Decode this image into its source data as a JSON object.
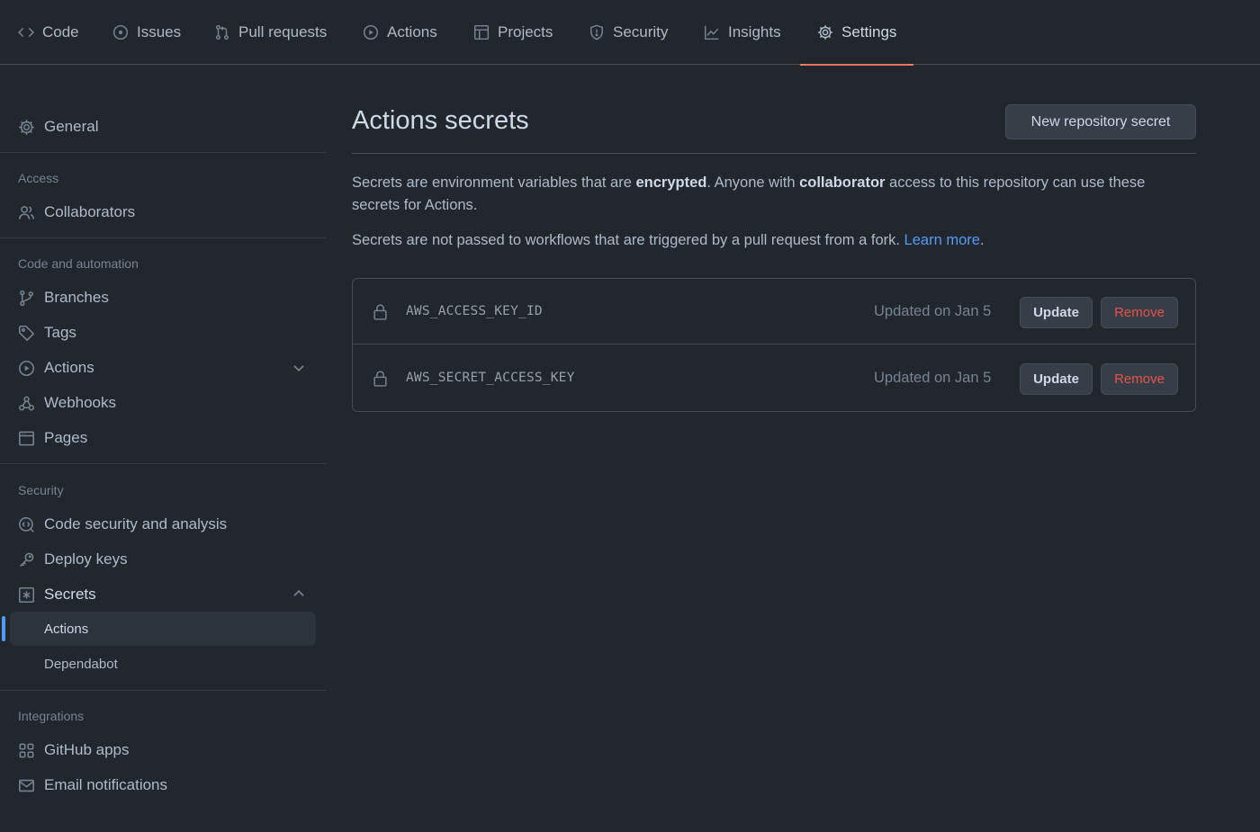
{
  "tabs": [
    {
      "label": "Code",
      "icon": "code-icon"
    },
    {
      "label": "Issues",
      "icon": "issue-opened-icon"
    },
    {
      "label": "Pull requests",
      "icon": "git-pull-request-icon"
    },
    {
      "label": "Actions",
      "icon": "play-icon"
    },
    {
      "label": "Projects",
      "icon": "table-icon"
    },
    {
      "label": "Security",
      "icon": "shield-icon"
    },
    {
      "label": "Insights",
      "icon": "graph-icon"
    },
    {
      "label": "Settings",
      "icon": "gear-icon",
      "selected": true
    }
  ],
  "sidebar": {
    "general": "General",
    "access_heading": "Access",
    "collaborators": "Collaborators",
    "code_heading": "Code and automation",
    "branches": "Branches",
    "tags": "Tags",
    "actions": "Actions",
    "webhooks": "Webhooks",
    "pages": "Pages",
    "security_heading": "Security",
    "code_security": "Code security and analysis",
    "deploy_keys": "Deploy keys",
    "secrets": "Secrets",
    "secrets_sub": [
      "Actions",
      "Dependabot"
    ],
    "integrations_heading": "Integrations",
    "github_apps": "GitHub apps",
    "email_notifications": "Email notifications"
  },
  "main": {
    "title": "Actions secrets",
    "new_button": "New repository secret",
    "desc1": {
      "p1": "Secrets are environment variables that are ",
      "b1": "encrypted",
      "p2": ". Anyone with ",
      "b2": "collaborator",
      "p3": " access to this repository can use these secrets for Actions."
    },
    "desc2": {
      "text": "Secrets are not passed to workflows that are triggered by a pull request from a fork. ",
      "link": "Learn more",
      "end": "."
    },
    "secrets": [
      {
        "name": "AWS_ACCESS_KEY_ID",
        "updated": "Updated on Jan 5",
        "update_label": "Update",
        "remove_label": "Remove"
      },
      {
        "name": "AWS_SECRET_ACCESS_KEY",
        "updated": "Updated on Jan 5",
        "update_label": "Update",
        "remove_label": "Remove"
      }
    ]
  },
  "colors": {
    "background": "#22272e",
    "accent_underline": "#ec775c",
    "link": "#539bf5",
    "danger": "#e5534b"
  }
}
